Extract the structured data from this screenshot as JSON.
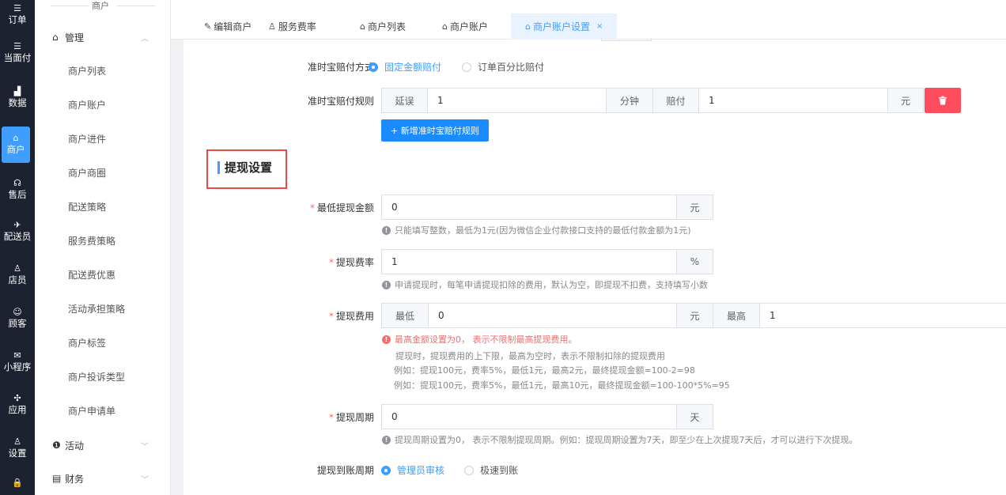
{
  "iconbar": {
    "items": [
      {
        "icon": "☰",
        "label": "订单"
      },
      {
        "icon": "☰",
        "label": "当面付"
      },
      {
        "icon": "▟",
        "label": "数据"
      },
      {
        "icon": "⌂",
        "label": "商户"
      },
      {
        "icon": "☊",
        "label": "售后"
      },
      {
        "icon": "✈",
        "label": "配送员"
      },
      {
        "icon": "♙",
        "label": "店员"
      },
      {
        "icon": "☺",
        "label": "顾客"
      },
      {
        "icon": "✉",
        "label": "小程序"
      },
      {
        "icon": "✣",
        "label": "应用"
      },
      {
        "icon": "♙",
        "label": "设置"
      },
      {
        "icon": "🔒",
        "label": ""
      }
    ],
    "active_index": 3,
    "accent": "#409eff"
  },
  "submenu": {
    "header": "商户",
    "group_manage": {
      "icon": "⌂",
      "label": "管理"
    },
    "items": [
      "商户列表",
      "商户账户",
      "商户进件",
      "商户商圈",
      "配送策略",
      "服务费策略",
      "配送费优惠",
      "活动承担策略",
      "商户标签",
      "商户投诉类型",
      "商户申请单"
    ],
    "group_activity": {
      "icon": "❶",
      "label": "活动"
    },
    "group_finance": {
      "icon": "▤",
      "label": "财务"
    }
  },
  "tabs": [
    {
      "icon": "✎",
      "label": "编辑商户"
    },
    {
      "icon": "♙",
      "label": "服务费率"
    },
    {
      "icon": "⌂",
      "label": "商户列表"
    },
    {
      "icon": "⌂",
      "label": "商户账户"
    },
    {
      "icon": "⌂",
      "label": "商户账户设置",
      "close": "×"
    }
  ],
  "form": {
    "compensation_mode": {
      "label": "准时宝赔付方式",
      "options": [
        "固定金额赔付",
        "订单百分比赔付"
      ],
      "selected": "固定金额赔付"
    },
    "compensation_rule": {
      "label": "准时宝赔付规则",
      "prefix": "延误",
      "delay_value": "1",
      "delay_unit": "分钟",
      "pay_prefix": "赔付",
      "pay_value": "1",
      "pay_unit": "元",
      "add_button": "+ 新增准时宝赔付规则"
    },
    "section_title": "提现设置",
    "min_withdraw": {
      "label": "最低提现金额",
      "value": "0",
      "unit": "元",
      "hint": "只能填写整数，最低为1元(因为微信企业付款接口支持的最低付款金额为1元)"
    },
    "withdraw_rate": {
      "label": "提现费率",
      "value": "1",
      "unit": "%",
      "hint": "申请提现时，每笔申请提现扣除的费用，默认为空，即提现不扣费，支持填写小数"
    },
    "withdraw_fee": {
      "label": "提现费用",
      "min_prefix": "最低",
      "min_value": "0",
      "min_unit": "元",
      "max_prefix": "最高",
      "max_value": "1",
      "warning": "最高金额设置为0， 表示不限制最高提现费用。",
      "notes": [
        "提现时，提现费用的上下限，最高为空时，表示不限制扣除的提现费用",
        "例如：提现100元，费率5%，最低1元，最高2元，最终提现金额=100-2=98",
        "例如：提现100元，费率5%，最低1元，最高10元，最终提现金额=100-100*5%=95"
      ]
    },
    "withdraw_period": {
      "label": "提现周期",
      "value": "0",
      "unit": "天",
      "hint": "提现周期设置为0， 表示不限制提现周期。例如：提现周期设置为7天，即至少在上次提现7天后，才可以进行下次提现。"
    },
    "arrival_period": {
      "label": "提现到账周期",
      "options": [
        "管理员审核",
        "极速到账"
      ],
      "selected": "管理员审核"
    }
  }
}
